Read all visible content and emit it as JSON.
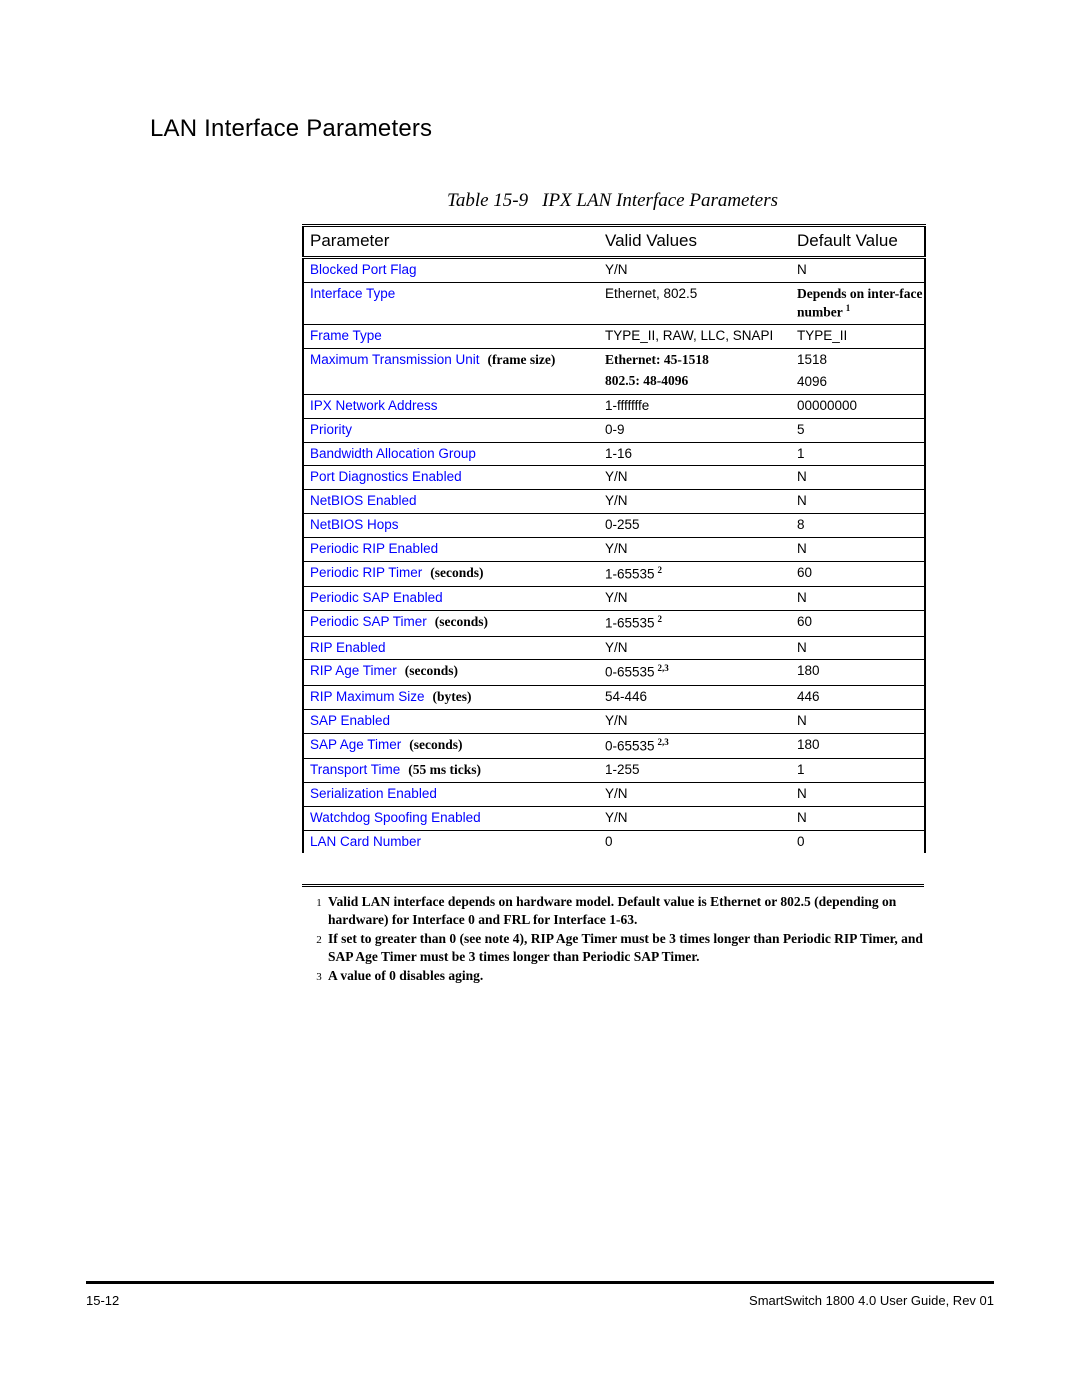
{
  "page": {
    "heading": "LAN Interface Parameters"
  },
  "table": {
    "caption_number": "Table 15-9",
    "caption_title": "IPX LAN Interface Parameters",
    "columns": [
      "Parameter",
      "Valid Values",
      "Default Value"
    ],
    "rows": [
      {
        "parameter": "Blocked Port Flag",
        "unit": "",
        "valid": "Y/N",
        "valid_note": "",
        "valid_line2": "",
        "default": "N",
        "default_line2": ""
      },
      {
        "parameter": "Interface Type",
        "unit": "",
        "valid": "Ethernet, 802.5",
        "valid_note": "",
        "valid_line2": "",
        "default": "Depends on inter-face number",
        "default_note": "1",
        "default_line2": ""
      },
      {
        "parameter": "Frame Type",
        "unit": "",
        "valid": "TYPE_II, RAW, LLC, SNAPI",
        "valid_note": "",
        "valid_line2": "",
        "default": "TYPE_II",
        "default_line2": ""
      },
      {
        "parameter": "Maximum Transmission Unit",
        "unit": "(frame size)",
        "valid": "Ethernet: 45-1518",
        "valid_note": "",
        "valid_line2": "802.5: 48-4096",
        "default": "1518",
        "default_line2": "4096"
      },
      {
        "parameter": "IPX Network Address",
        "unit": "",
        "valid": "1-fffffffe",
        "valid_note": "",
        "valid_line2": "",
        "default": "00000000",
        "default_line2": ""
      },
      {
        "parameter": "Priority",
        "unit": "",
        "valid": "0-9",
        "valid_note": "",
        "valid_line2": "",
        "default": "5",
        "default_line2": ""
      },
      {
        "parameter": "Bandwidth Allocation Group",
        "unit": "",
        "valid": "1-16",
        "valid_note": "",
        "valid_line2": "",
        "default": "1",
        "default_line2": ""
      },
      {
        "parameter": "Port Diagnostics Enabled",
        "unit": "",
        "valid": "Y/N",
        "valid_note": "",
        "valid_line2": "",
        "default": "N",
        "default_line2": ""
      },
      {
        "parameter": "NetBIOS Enabled",
        "unit": "",
        "valid": "Y/N",
        "valid_note": "",
        "valid_line2": "",
        "default": "N",
        "default_line2": ""
      },
      {
        "parameter": "NetBIOS Hops",
        "unit": "",
        "valid": "0-255",
        "valid_note": "",
        "valid_line2": "",
        "default": "8",
        "default_line2": ""
      },
      {
        "parameter": "Periodic RIP Enabled",
        "unit": "",
        "valid": "Y/N",
        "valid_note": "",
        "valid_line2": "",
        "default": "N",
        "default_line2": ""
      },
      {
        "parameter": "Periodic RIP Timer",
        "unit": "(seconds)",
        "valid": "1-65535",
        "valid_note": "2",
        "valid_line2": "",
        "default": "60",
        "default_line2": ""
      },
      {
        "parameter": "Periodic SAP Enabled",
        "unit": "",
        "valid": "Y/N",
        "valid_note": "",
        "valid_line2": "",
        "default": "N",
        "default_line2": ""
      },
      {
        "parameter": "Periodic SAP Timer",
        "unit": "(seconds)",
        "valid": "1-65535",
        "valid_note": "2",
        "valid_line2": "",
        "default": "60",
        "default_line2": ""
      },
      {
        "parameter": "RIP Enabled",
        "unit": "",
        "valid": "Y/N",
        "valid_note": "",
        "valid_line2": "",
        "default": "N",
        "default_line2": ""
      },
      {
        "parameter": "RIP Age Timer",
        "unit": "(seconds)",
        "valid": "0-65535",
        "valid_note": "2,3",
        "valid_line2": "",
        "default": "180",
        "default_line2": ""
      },
      {
        "parameter": "RIP Maximum Size",
        "unit": "(bytes)",
        "valid": "54-446",
        "valid_note": "",
        "valid_line2": "",
        "default": "446",
        "default_line2": ""
      },
      {
        "parameter": "SAP Enabled",
        "unit": "",
        "valid": "Y/N",
        "valid_note": "",
        "valid_line2": "",
        "default": "N",
        "default_line2": ""
      },
      {
        "parameter": "SAP Age Timer",
        "unit": "(seconds)",
        "valid": "0-65535",
        "valid_note": "2,3",
        "valid_line2": "",
        "default": "180",
        "default_line2": ""
      },
      {
        "parameter": "Transport Time",
        "unit": "(55 ms ticks)",
        "valid": "1-255",
        "valid_note": "",
        "valid_line2": "",
        "default": "1",
        "default_line2": ""
      },
      {
        "parameter": "Serialization Enabled",
        "unit": "",
        "valid": "Y/N",
        "valid_note": "",
        "valid_line2": "",
        "default": "N",
        "default_line2": ""
      },
      {
        "parameter": "Watchdog Spoofing Enabled",
        "unit": "",
        "valid": "Y/N",
        "valid_note": "",
        "valid_line2": "",
        "default": "N",
        "default_line2": ""
      },
      {
        "parameter": "LAN Card Number",
        "unit": "",
        "valid": "0",
        "valid_note": "",
        "valid_line2": "",
        "default": "0",
        "default_line2": ""
      }
    ],
    "footnotes": [
      {
        "number": "1",
        "text": "Valid LAN interface depends on hardware model. Default value is Ethernet or 802.5 (depending on hardware) for Interface 0 and FRL for Interface 1-63."
      },
      {
        "number": "2",
        "text": "If set to greater than 0 (see note 4), RIP Age Timer must be 3 times longer than Periodic RIP Timer, and SAP Age Timer must be 3 times longer than Periodic SAP Timer."
      },
      {
        "number": "3",
        "text": "A value of 0 disables aging."
      }
    ]
  },
  "footer": {
    "page_number": "15-12",
    "guide": "SmartSwitch 1800 4.0 User Guide, Rev 01"
  },
  "colors": {
    "parameter_name": "#0000ff",
    "text": "#000000",
    "background": "#ffffff"
  }
}
